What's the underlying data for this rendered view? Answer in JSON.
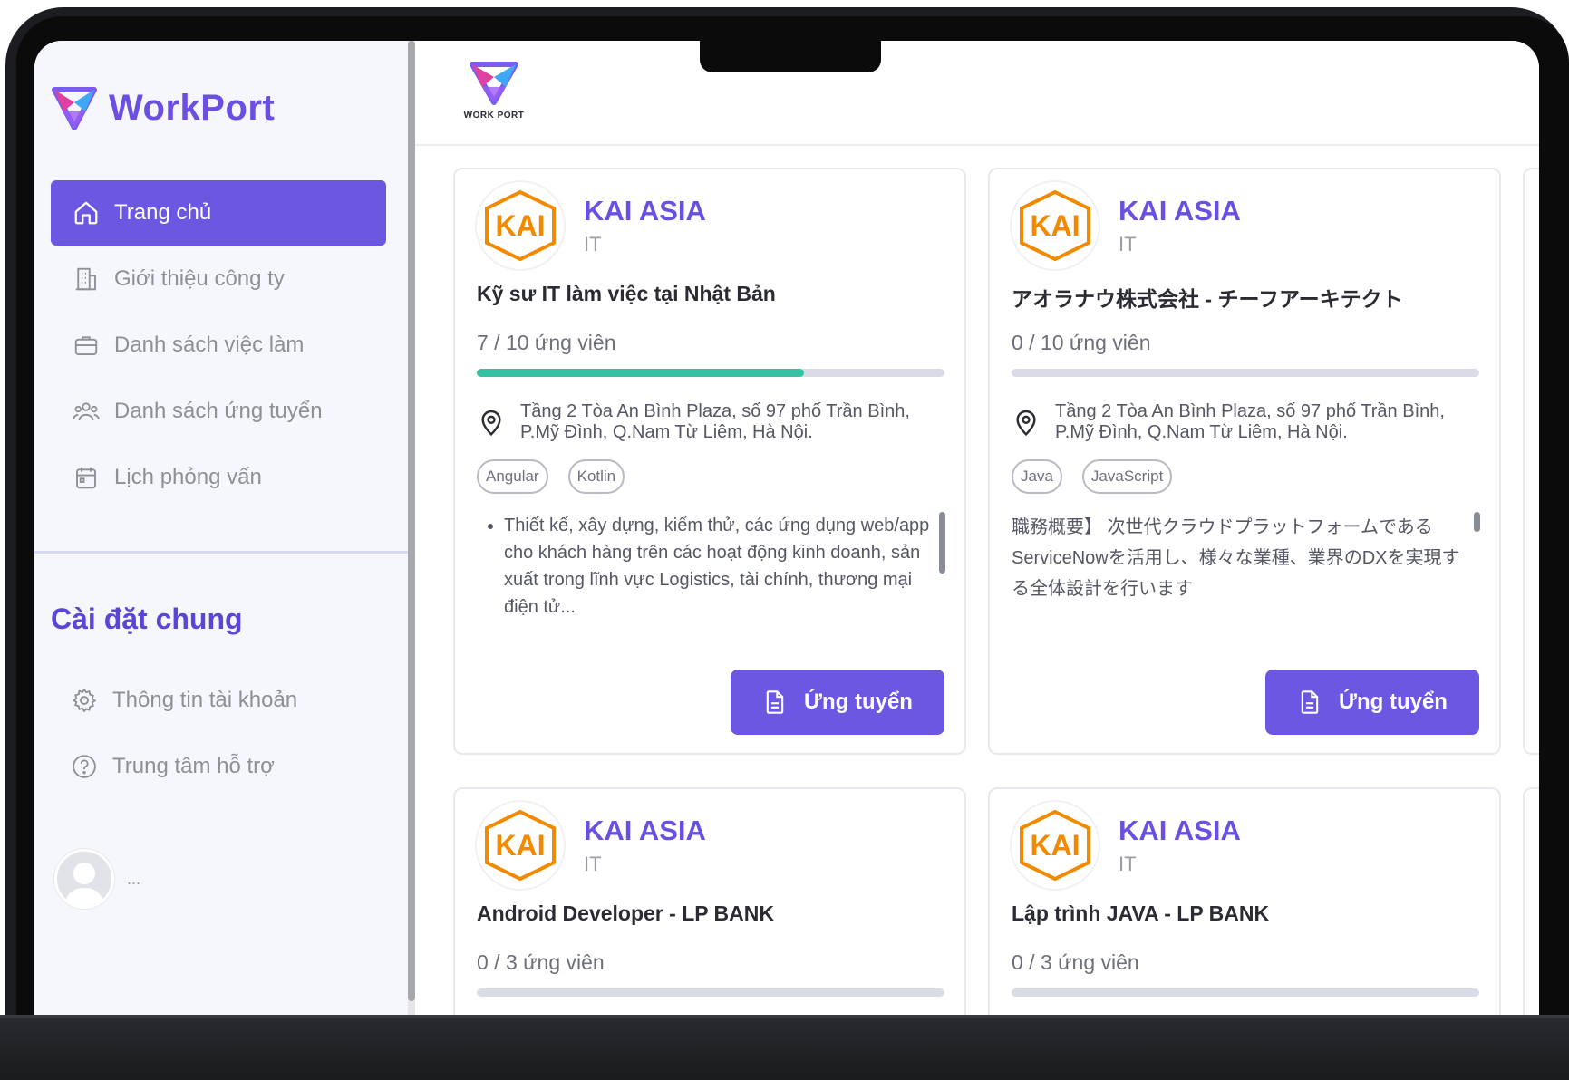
{
  "brand": {
    "name": "WorkPort",
    "top_logo_text": "WORK PORT"
  },
  "sidebar": {
    "items": [
      {
        "label": "Trang chủ",
        "icon": "home-icon",
        "active": true
      },
      {
        "label": "Giới thiệu công ty",
        "icon": "building-icon",
        "active": false
      },
      {
        "label": "Danh sách việc làm",
        "icon": "briefcase-icon",
        "active": false
      },
      {
        "label": "Danh sách ứng tuyển",
        "icon": "users-icon",
        "active": false
      },
      {
        "label": "Lịch phỏng vấn",
        "icon": "calendar-icon",
        "active": false
      }
    ],
    "settings_title": "Cài đặt chung",
    "settings_items": [
      {
        "label": "Thông tin tài khoản",
        "icon": "gear-icon"
      },
      {
        "label": "Trung tâm hỗ trợ",
        "icon": "help-circle-icon"
      }
    ],
    "user_name": "..."
  },
  "colors": {
    "accent": "#6c57e3",
    "progress": "#35c2a0",
    "company": "#6b4fe0"
  },
  "jobs": [
    {
      "company": "KAI ASIA",
      "logo_text": "KAI",
      "industry": "IT",
      "title": "Kỹ sư IT làm việc tại Nhật Bản",
      "applicants": "7 / 10 ứng viên",
      "progress": 0.7,
      "address": "Tầng 2 Tòa An Bình Plaza, số 97 phố Trần Bình, P.Mỹ Đình, Q.Nam Từ Liêm, Hà Nội.",
      "tags": [
        "Angular",
        "Kotlin"
      ],
      "description": "Thiết kế, xây dựng, kiểm thử, các ứng dụng web/app cho khách hàng trên các hoạt động kinh doanh, sản xuất trong lĩnh vực Logistics, tài chính, thương mại điện tử...",
      "apply_label": "Ứng tuyển"
    },
    {
      "company": "KAI ASIA",
      "logo_text": "KAI",
      "industry": "IT",
      "title": "アオラナウ株式会社 - チーフアーキテクト",
      "applicants": "0 / 10 ứng viên",
      "progress": 0,
      "address": "Tầng 2 Tòa An Bình Plaza, số 97 phố Trần Bình, P.Mỹ Đình, Q.Nam Từ Liêm, Hà Nội.",
      "tags": [
        "Java",
        "JavaScript"
      ],
      "description": "職務概要】 次世代クラウドプラットフォームであるServiceNowを活用し、様々な業種、業界のDXを実現する全体設計を行います",
      "apply_label": "Ứng tuyển"
    },
    {
      "company": "KAI ASIA",
      "logo_text": "KAI",
      "industry": "IT",
      "title": "Android Developer - LP BANK",
      "applicants": "0 / 3 ứng viên",
      "progress": 0
    },
    {
      "company": "KAI ASIA",
      "logo_text": "KAI",
      "industry": "IT",
      "title": "Lập trình JAVA - LP BANK",
      "applicants": "0 / 3 ứng viên",
      "progress": 0
    }
  ]
}
